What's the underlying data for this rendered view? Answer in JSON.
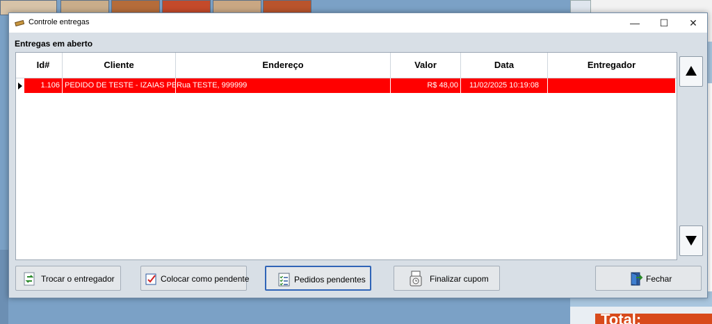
{
  "window": {
    "title": "Controle entregas",
    "controls": {
      "minimize": "—",
      "maximize": "☐",
      "close": "✕"
    }
  },
  "section_title": "Entregas em aberto",
  "grid": {
    "columns": [
      "Id#",
      "Cliente",
      "Endereço",
      "Valor",
      "Data",
      "Entregador"
    ],
    "rows": [
      {
        "id": "1.106",
        "cliente": "PEDIDO DE TESTE -  IZAIAS PE",
        "endereco": "Rua TESTE, 999999",
        "valor": "R$ 48,00",
        "data": "11/02/2025 10:19:08",
        "entregador": ""
      }
    ],
    "selected_row_color": "#ff0000"
  },
  "buttons": {
    "trocar": "Trocar o entregador",
    "pendente": "Colocar como pendente",
    "pedidos": "Pedidos pendentes",
    "finalizar": "Finalizar cupom",
    "fechar": "Fechar"
  },
  "background": {
    "total_label": "Total:"
  }
}
